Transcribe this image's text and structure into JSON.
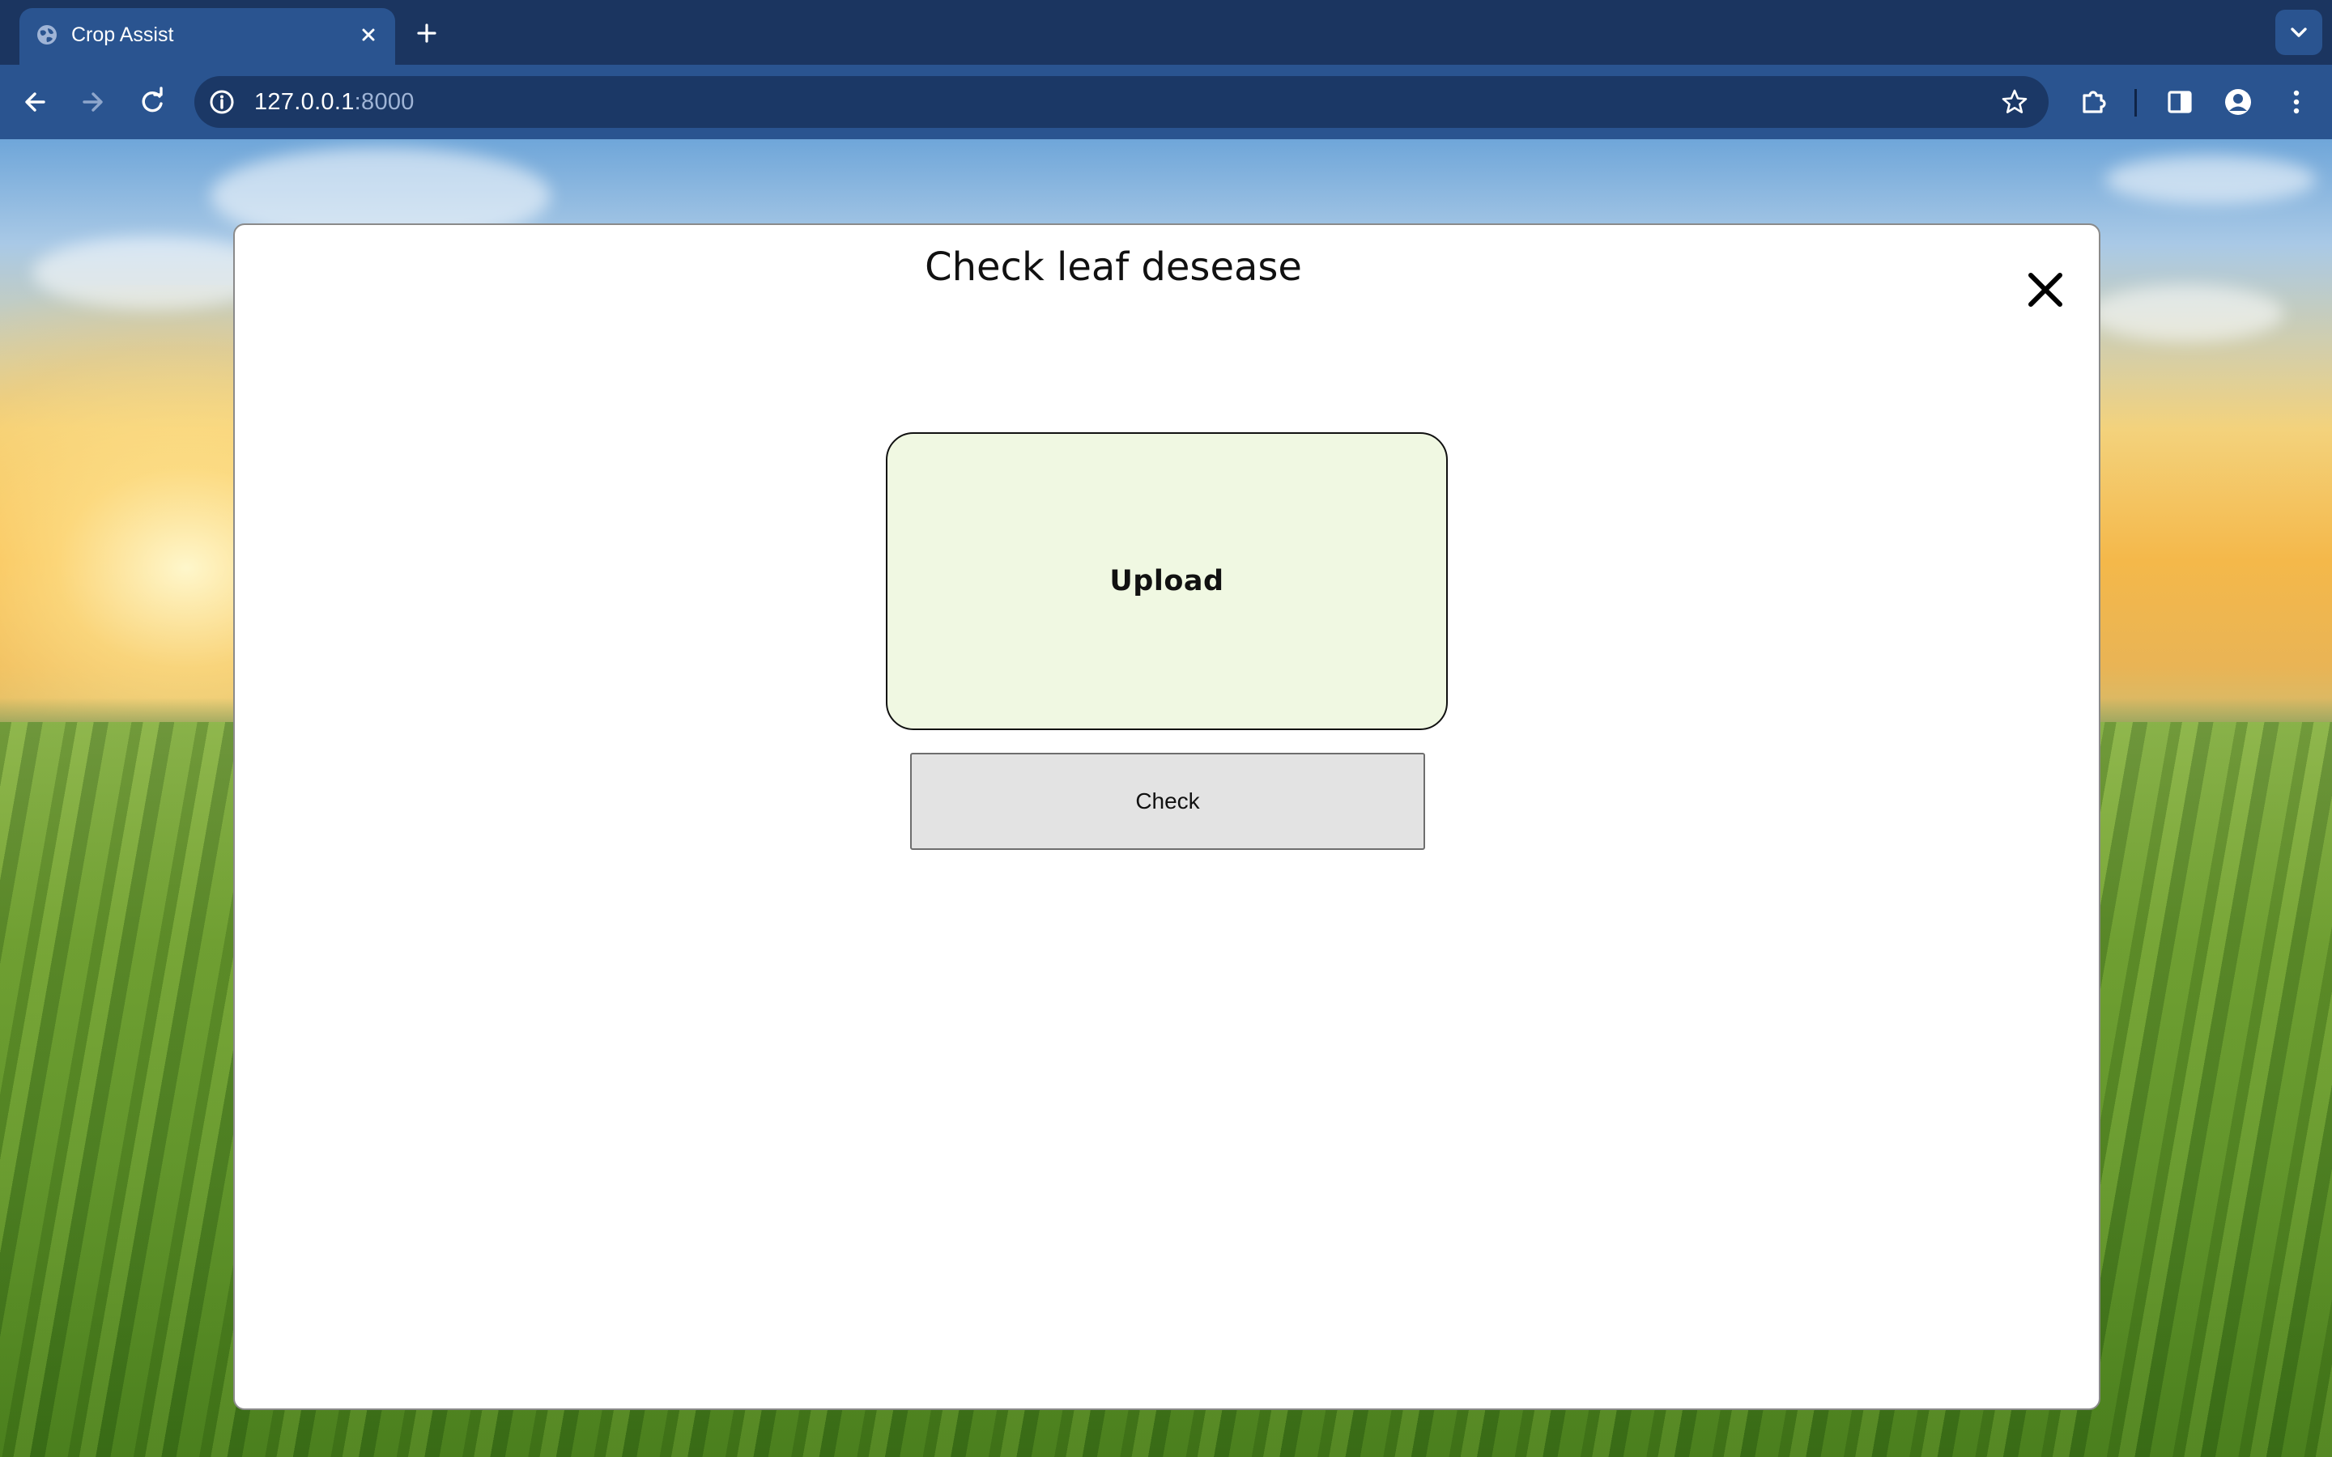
{
  "browser": {
    "tab": {
      "title": "Crop Assist",
      "favicon": "globe-icon"
    },
    "address_bar": {
      "host": "127.0.0.1",
      "port": ":8000"
    },
    "toolbar_icons": [
      "back-icon",
      "forward-icon",
      "reload-icon",
      "site-info-icon",
      "bookmark-star-icon",
      "extensions-icon",
      "side-panel-icon",
      "profile-icon",
      "menu-icon"
    ],
    "colors": {
      "tabstrip": "#1b3560",
      "toolbar": "#2a5490",
      "omnibox": "#1b3866"
    }
  },
  "modal": {
    "title": "Check leaf desease",
    "close_icon": "close-icon",
    "upload_label": "Upload",
    "check_label": "Check",
    "colors": {
      "upload_background": "#f0f8e2",
      "check_background": "#e3e3e3"
    }
  }
}
